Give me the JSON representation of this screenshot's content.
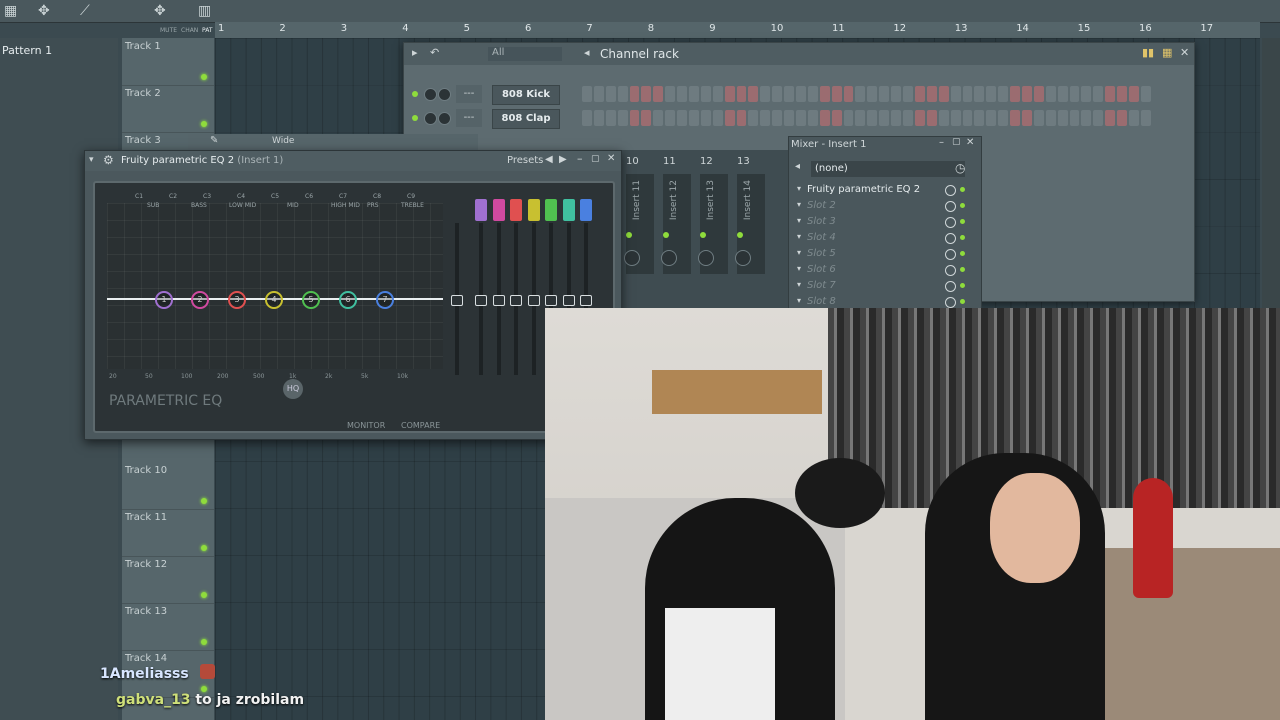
{
  "toolbar": {
    "menu_labels": [
      "MUTE",
      "CHAN",
      "PAT"
    ]
  },
  "browser": {
    "pattern_label": "Pattern 1"
  },
  "timeline": {
    "bars": [
      "1",
      "2",
      "3",
      "4",
      "5",
      "6",
      "7",
      "8",
      "9",
      "10",
      "11",
      "12",
      "13",
      "14",
      "15",
      "16",
      "17"
    ]
  },
  "tracks": [
    {
      "label": "Track 1"
    },
    {
      "label": "Track 2"
    },
    {
      "label": "Track 3"
    },
    {
      "label": "Track 10"
    },
    {
      "label": "Track 11"
    },
    {
      "label": "Track 12"
    },
    {
      "label": "Track 13"
    },
    {
      "label": "Track 14"
    }
  ],
  "channel_rack": {
    "title": "Channel rack",
    "filter": "All",
    "channels": [
      {
        "name": "808 Kick"
      },
      {
        "name": "808 Clap"
      }
    ],
    "empty_label": "---"
  },
  "mixer": {
    "title": "Mixer - Insert 1",
    "routing": "(none)",
    "slots": [
      "Fruity parametric EQ 2",
      "Slot 2",
      "Slot 3",
      "Slot 4",
      "Slot 5",
      "Slot 6",
      "Slot 7",
      "Slot 8"
    ],
    "strip_numbers": [
      "10",
      "11",
      "12",
      "13"
    ],
    "strips": [
      "Insert 11",
      "Insert 12",
      "Insert 13",
      "Insert 14"
    ]
  },
  "eq": {
    "title": "Fruity parametric EQ 2",
    "insert": "(Insert 1)",
    "presets_label": "Presets",
    "bands_top": [
      "C1",
      "C2",
      "C3",
      "C4",
      "C5",
      "C6",
      "C7",
      "C8",
      "C9"
    ],
    "band_groups": [
      "SUB",
      "BASS",
      "LOW MID",
      "MID",
      "HIGH MID",
      "PRS",
      "TREBLE"
    ],
    "freq_labels": [
      "20",
      "50",
      "100",
      "200",
      "500",
      "1k",
      "2k",
      "5k",
      "10k"
    ],
    "logo": "PARAMETRIC EQ",
    "monitor_label": "MONITOR",
    "compare_label": "COMPARE",
    "hq_label": "HQ",
    "band_colors": [
      "#a070d0",
      "#d04aa0",
      "#e05050",
      "#c8c030",
      "#50c050",
      "#40c0a0",
      "#4a80e0"
    ]
  },
  "layer_label": "Wide",
  "chat": [
    {
      "user": "1Ameliasss",
      "message": ""
    },
    {
      "user": "gabva_13",
      "message": "to ja zrobilam"
    }
  ]
}
